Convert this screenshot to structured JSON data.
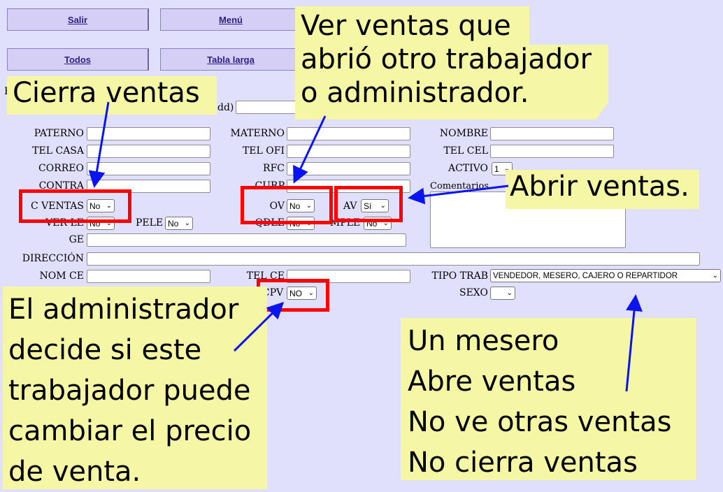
{
  "nav": {
    "salir": "Salir",
    "menu": "Menú",
    "todos": "Todos",
    "tabla_larga": "Tabla larga"
  },
  "partial": {
    "h": "H",
    "f": "F",
    "date_hint": "dd)"
  },
  "form": {
    "paterno": "PATERNO",
    "materno": "MATERNO",
    "nombre": "NOMBRE",
    "tel_casa": "TEL CASA",
    "tel_ofi": "TEL OFI",
    "tel_cel": "TEL CEL",
    "correo": "CORREO",
    "rfc": "RFC",
    "activo": "ACTIVO",
    "activo_value": "1",
    "contra": "CONTRA",
    "curp": "CURP",
    "comentarios": "Comentarios",
    "c_ventas": "C VENTAS",
    "c_ventas_value": "No",
    "ov": "OV",
    "ov_value": "No",
    "av": "AV",
    "av_value": "Sí",
    "ver_le": "VER LE",
    "ver_le_value": "No",
    "pele": "PELE",
    "pele_value": "No",
    "qdle": "QDLE",
    "qdle_value": "No",
    "mple": "MPLE",
    "mple_value": "No",
    "ge": "GE",
    "direccion": "DIRECCIÓN",
    "nom_ce": "NOM CE",
    "tel_ce": "TEL CE",
    "tipo_trab": "TIPO TRAB",
    "tipo_trab_value": "VENDEDOR, MESERO, CAJERO O REPARTIDOR",
    "cpv": "CPV",
    "cpv_value": "NO",
    "sexo": "SEXO",
    "sexo_value": ""
  },
  "annotations": {
    "cierra": "Cierra ventas",
    "ver_line1": "Ver ventas que",
    "ver_line2": "abrió otro trabajador",
    "ver_line3": "o administrador.",
    "abrir": "Abrir ventas.",
    "admin_line1": "El administrador",
    "admin_line2": "decide si este",
    "admin_line3": "trabajador puede",
    "admin_line4": "cambiar el precio",
    "admin_line5": "de venta.",
    "mesero_line1": "Un mesero",
    "mesero_line2": "Abre ventas",
    "mesero_line3": "No ve otras ventas",
    "mesero_line4": "No cierra ventas"
  },
  "colors": {
    "background": "#e0e0fc",
    "note": "#f5f7a4",
    "highlight": "#ff0000",
    "arrow": "#0a14f0",
    "nav_text": "#2b1f86"
  }
}
